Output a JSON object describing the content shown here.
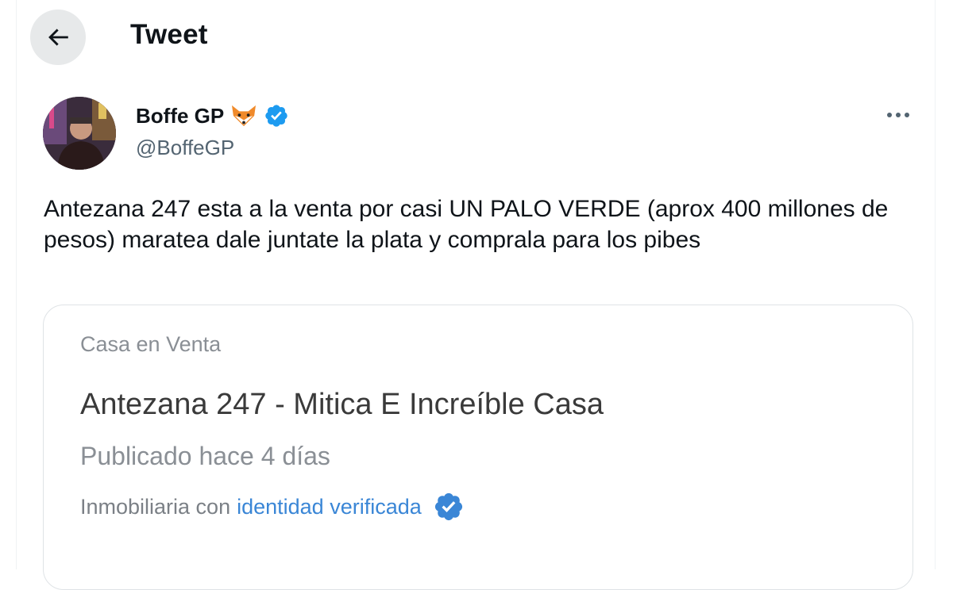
{
  "header": {
    "title": "Tweet",
    "back_icon": "arrow-left-icon"
  },
  "author": {
    "name": "Boffe GP",
    "handle": "@BoffeGP",
    "emoji_icon": "fox-face-icon",
    "verified_icon": "verified-badge-icon",
    "verified_color": "#1d9bf0"
  },
  "tweet": {
    "text": "Antezana 247 esta a la venta por casi UN PALO VERDE (aprox 400 millones de pesos) maratea dale juntate la plata y comprala para los pibes"
  },
  "card": {
    "category": "Casa en Venta",
    "title": "Antezana 247 - Mitica E Increíble Casa",
    "published": "Publicado hace 4 días",
    "agency_prefix": "Inmobiliaria con",
    "agency_link": "identidad verificada",
    "agency_badge_color": "#3a86d6"
  }
}
